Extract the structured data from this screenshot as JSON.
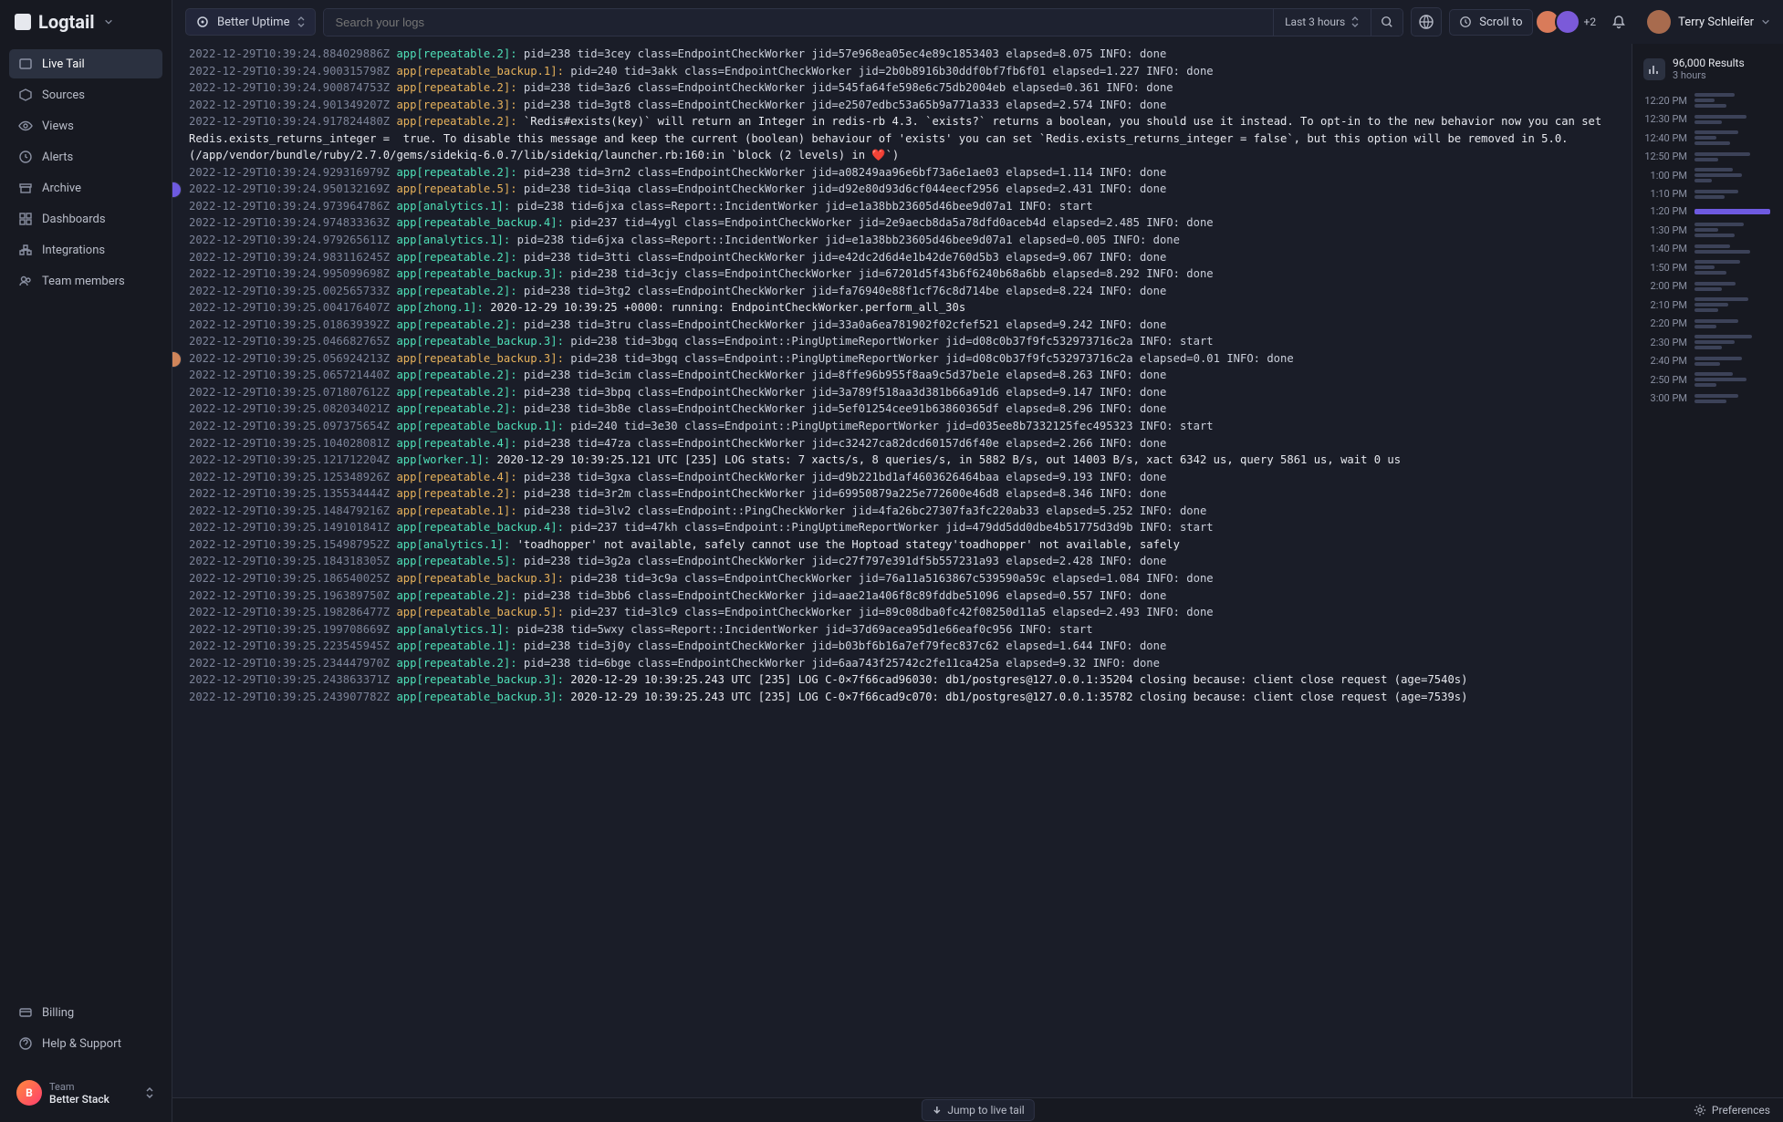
{
  "brand": "Logtail",
  "sidebar": {
    "items": [
      {
        "label": "Live Tail",
        "active": true,
        "icon": "live-tail-icon"
      },
      {
        "label": "Sources",
        "icon": "sources-icon"
      },
      {
        "label": "Views",
        "icon": "views-icon"
      },
      {
        "label": "Alerts",
        "icon": "alerts-icon"
      },
      {
        "label": "Archive",
        "icon": "archive-icon"
      },
      {
        "label": "Dashboards",
        "icon": "dashboards-icon"
      },
      {
        "label": "Integrations",
        "icon": "integrations-icon"
      },
      {
        "label": "Team members",
        "icon": "team-members-icon"
      }
    ],
    "bottom": [
      {
        "label": "Billing",
        "icon": "billing-icon"
      },
      {
        "label": "Help & Support",
        "icon": "help-icon"
      }
    ],
    "team": {
      "prefix": "Team",
      "name": "Better Stack"
    }
  },
  "topbar": {
    "source_selector": "Better Uptime",
    "search_placeholder": "Search your logs",
    "time_range": "Last 3 hours",
    "scroll_to": "Scroll to",
    "avatar_plus": "+2",
    "user_name": "Terry Schleifer"
  },
  "results": {
    "count": "96,000 Results",
    "subtitle": "3 hours"
  },
  "timeline_labels": [
    "12:20 PM",
    "12:30 PM",
    "12:40 PM",
    "12:50 PM",
    "1:00 PM",
    "1:10 PM",
    "1:20 PM",
    "1:30 PM",
    "1:40 PM",
    "1:50 PM",
    "2:00 PM",
    "2:10 PM",
    "2:20 PM",
    "2:30 PM",
    "2:40 PM",
    "2:50 PM",
    "3:00 PM"
  ],
  "timeline_highlight_index": 6,
  "bottombar": {
    "jump": "Jump to live tail",
    "prefs": "Preferences"
  },
  "logs": [
    {
      "ts": "2022-12-29T10:39:24.884029886Z",
      "tag": "app[repeatable.2]:",
      "tag_color": "green",
      "rest": "pid=238 tid=3cey class=EndpointCheckWorker jid=57e968ea05ec4e89c1853403 elapsed=8.075 INFO: done"
    },
    {
      "ts": "2022-12-29T10:39:24.900315798Z",
      "tag": "app[repeatable_backup.1]:",
      "tag_color": "orange",
      "rest": "pid=240 tid=3akk class=EndpointCheckWorker jid=2b0b8916b30ddf0bf7fb6f01 elapsed=1.227 INFO: done"
    },
    {
      "ts": "2022-12-29T10:39:24.900874753Z",
      "tag": "app[repeatable.2]:",
      "tag_color": "orange",
      "rest": "pid=238 tid=3az6 class=EndpointCheckWorker jid=545fa64fe598e6c75db2004eb elapsed=0.361 INFO: done"
    },
    {
      "ts": "2022-12-29T10:39:24.901349207Z",
      "tag": "app[repeatable.3]:",
      "tag_color": "orange",
      "rest": "pid=238 tid=3gt8 class=EndpointCheckWorker jid=e2507edbc53a65b9a771a333 elapsed=2.574 INFO: done"
    },
    {
      "ts": "2022-12-29T10:39:24.917824480Z",
      "tag": "app[repeatable.2]:",
      "tag_color": "orange",
      "rest": "`Redis#exists(key)` will return an Integer in redis-rb 4.3. `exists?` returns a boolean, you should use it instead. To opt-in to the new behavior now you can set Redis.exists_returns_integer =  true. To disable this message and keep the current (boolean) behaviour of 'exists' you can set `Redis.exists_returns_integer = false`, but this option will be removed in 5.0. (/app/vendor/bundle/ruby/2.7.0/gems/sidekiq-6.0.7/lib/sidekiq/launcher.rb:160:in `block (2 levels) in ❤️`)",
      "text": true
    },
    {
      "ts": "2022-12-29T10:39:24.929316979Z",
      "tag": "app[repeatable.2]:",
      "tag_color": "green",
      "rest": "pid=238 tid=3rn2 class=EndpointCheckWorker jid=a08249aa96e6bf73a6e1ae03 elapsed=1.114 INFO: done"
    },
    {
      "ts": "2022-12-29T10:39:24.950132169Z",
      "tag": "app[repeatable.5]:",
      "tag_color": "orange",
      "rest": "pid=238 tid=3iqa class=EndpointCheckWorker jid=d92e80d93d6cf044eecf2956 elapsed=2.431 INFO: done",
      "avatar": 1
    },
    {
      "ts": "2022-12-29T10:39:24.973964786Z",
      "tag": "app[analytics.1]:",
      "tag_color": "green",
      "rest": "pid=238 tid=6jxa class=Report::IncidentWorker jid=e1a38bb23605d46bee9d07a1 INFO: start"
    },
    {
      "ts": "2022-12-29T10:39:24.974833363Z",
      "tag": "app[repeatable_backup.4]:",
      "tag_color": "green",
      "rest": "pid=237 tid=4ygl class=EndpointCheckWorker jid=2e9aecb8da5a78dfd0aceb4d elapsed=2.485 INFO: done"
    },
    {
      "ts": "2022-12-29T10:39:24.979265611Z",
      "tag": "app[analytics.1]:",
      "tag_color": "green",
      "rest": "pid=238 tid=6jxa class=Report::IncidentWorker jid=e1a38bb23605d46bee9d07a1 elapsed=0.005 INFO: done"
    },
    {
      "ts": "2022-12-29T10:39:24.983116245Z",
      "tag": "app[repeatable.2]:",
      "tag_color": "green",
      "rest": "pid=238 tid=3tti class=EndpointCheckWorker jid=e42dc2d6d4e1b42de760d5b3 elapsed=9.067 INFO: done"
    },
    {
      "ts": "2022-12-29T10:39:24.995099698Z",
      "tag": "app[repeatable_backup.3]:",
      "tag_color": "green",
      "rest": "pid=238 tid=3cjy class=EndpointCheckWorker jid=67201d5f43b6f6240b68a6bb elapsed=8.292 INFO: done"
    },
    {
      "ts": "2022-12-29T10:39:25.002565733Z",
      "tag": "app[repeatable.2]:",
      "tag_color": "green",
      "rest": "pid=238 tid=3tg2 class=EndpointCheckWorker jid=fa76940e88f1cf76c8d714be elapsed=8.224 INFO: done"
    },
    {
      "ts": "2022-12-29T10:39:25.004176407Z",
      "tag": "app[zhong.1]:",
      "tag_color": "green",
      "rest": "2020-12-29 10:39:25 +0000: running: EndpointCheckWorker.perform_all_30s",
      "text": true
    },
    {
      "ts": "2022-12-29T10:39:25.018639392Z",
      "tag": "app[repeatable.2]:",
      "tag_color": "green",
      "rest": "pid=238 tid=3tru class=EndpointCheckWorker jid=33a0a6ea781902f02cfef521 elapsed=9.242 INFO: done"
    },
    {
      "ts": "2022-12-29T10:39:25.046682765Z",
      "tag": "app[repeatable_backup.3]:",
      "tag_color": "green",
      "rest": "pid=238 tid=3bgq class=Endpoint::PingUptimeReportWorker jid=d08c0b37f9fc532973716c2a INFO: start"
    },
    {
      "ts": "2022-12-29T10:39:25.056924213Z",
      "tag": "app[repeatable_backup.3]:",
      "tag_color": "orange",
      "rest": "pid=238 tid=3bgq class=Endpoint::PingUptimeReportWorker jid=d08c0b37f9fc532973716c2a elapsed=0.01 INFO: done",
      "avatar": 2
    },
    {
      "ts": "2022-12-29T10:39:25.065721440Z",
      "tag": "app[repeatable.2]:",
      "tag_color": "green",
      "rest": "pid=238 tid=3cim class=EndpointCheckWorker jid=8ffe96b955f8aa9c5d37be1e elapsed=8.263 INFO: done"
    },
    {
      "ts": "2022-12-29T10:39:25.071807612Z",
      "tag": "app[repeatable.2]:",
      "tag_color": "green",
      "rest": "pid=238 tid=3bpq class=EndpointCheckWorker jid=3a789f518aa3d381b66a91d6 elapsed=9.147 INFO: done"
    },
    {
      "ts": "2022-12-29T10:39:25.082034021Z",
      "tag": "app[repeatable.2]:",
      "tag_color": "green",
      "rest": "pid=238 tid=3b8e class=EndpointCheckWorker jid=5ef01254cee91b63860365df elapsed=8.296 INFO: done"
    },
    {
      "ts": "2022-12-29T10:39:25.097375654Z",
      "tag": "app[repeatable_backup.1]:",
      "tag_color": "green",
      "rest": "pid=240 tid=3e30 class=Endpoint::PingUptimeReportWorker jid=d035ee8b7332125fec495323 INFO: start"
    },
    {
      "ts": "2022-12-29T10:39:25.104028081Z",
      "tag": "app[repeatable.4]:",
      "tag_color": "green",
      "rest": "pid=238 tid=47za class=EndpointCheckWorker jid=c32427ca82dcd60157d6f40e elapsed=2.266 INFO: done"
    },
    {
      "ts": "2022-12-29T10:39:25.121712204Z",
      "tag": "app[worker.1]:",
      "tag_color": "green",
      "rest": "2020-12-29 10:39:25.121 UTC [235] LOG stats: 7 xacts/s, 8 queries/s, in 5882 B/s, out 14003 B/s, xact 6342 us, query 5861 us, wait 0 us",
      "text": true
    },
    {
      "ts": "2022-12-29T10:39:25.125348926Z",
      "tag": "app[repeatable.4]:",
      "tag_color": "orange",
      "rest": "pid=238 tid=3gxa class=EndpointCheckWorker jid=d9b221bd1af4603626464baa elapsed=9.193 INFO: done"
    },
    {
      "ts": "2022-12-29T10:39:25.135534444Z",
      "tag": "app[repeatable.2]:",
      "tag_color": "orange",
      "rest": "pid=238 tid=3r2m class=EndpointCheckWorker jid=69950879a225e772600e46d8 elapsed=8.346 INFO: done"
    },
    {
      "ts": "2022-12-29T10:39:25.148479216Z",
      "tag": "app[repeatable.1]:",
      "tag_color": "orange",
      "rest": "pid=238 tid=3lv2 class=Endpoint::PingCheckWorker jid=4fa26bc27307fa3fc220ab33 elapsed=5.252 INFO: done"
    },
    {
      "ts": "2022-12-29T10:39:25.149101841Z",
      "tag": "app[repeatable_backup.4]:",
      "tag_color": "green",
      "rest": "pid=237 tid=47kh class=Endpoint::PingUptimeReportWorker jid=479dd5dd0dbe4b51775d3d9b INFO: start"
    },
    {
      "ts": "2022-12-29T10:39:25.154987952Z",
      "tag": "app[analytics.1]:",
      "tag_color": "green",
      "rest": "'toadhopper' not available, safely cannot use the Hoptoad stategy'toadhopper' not available, safely",
      "text": true
    },
    {
      "ts": "2022-12-29T10:39:25.184318305Z",
      "tag": "app[repeatable.5]:",
      "tag_color": "green",
      "rest": "pid=238 tid=3g2a class=EndpointCheckWorker jid=c27f797e391df5b557231a93 elapsed=2.428 INFO: done"
    },
    {
      "ts": "2022-12-29T10:39:25.186540025Z",
      "tag": "app[repeatable_backup.3]:",
      "tag_color": "orange",
      "rest": "pid=238 tid=3c9a class=EndpointCheckWorker jid=76a11a5163867c539590a59c elapsed=1.084 INFO: done"
    },
    {
      "ts": "2022-12-29T10:39:25.196389750Z",
      "tag": "app[repeatable.2]:",
      "tag_color": "green",
      "rest": "pid=238 tid=3bb6 class=EndpointCheckWorker jid=aae21a406f8c89fddbe51096 elapsed=0.557 INFO: done"
    },
    {
      "ts": "2022-12-29T10:39:25.198286477Z",
      "tag": "app[repeatable_backup.5]:",
      "tag_color": "orange",
      "rest": "pid=237 tid=3lc9 class=EndpointCheckWorker jid=89c08dba0fc42f08250d11a5 elapsed=2.493 INFO: done"
    },
    {
      "ts": "2022-12-29T10:39:25.199708669Z",
      "tag": "app[analytics.1]:",
      "tag_color": "green",
      "rest": "pid=238 tid=5wxy class=Report::IncidentWorker jid=37d69acea95d1e66eaf0c956 INFO: start"
    },
    {
      "ts": "2022-12-29T10:39:25.223545945Z",
      "tag": "app[repeatable.1]:",
      "tag_color": "green",
      "rest": "pid=238 tid=3j0y class=EndpointCheckWorker jid=b03bf6b16a7ef79fec837c62 elapsed=1.644 INFO: done"
    },
    {
      "ts": "2022-12-29T10:39:25.234447970Z",
      "tag": "app[repeatable.2]:",
      "tag_color": "green",
      "rest": "pid=238 tid=6bge class=EndpointCheckWorker jid=6aa743f25742c2fe11ca425a elapsed=9.32 INFO: done"
    },
    {
      "ts": "2022-12-29T10:39:25.243863371Z",
      "tag": "app[repeatable_backup.3]:",
      "tag_color": "green",
      "rest": "2020-12-29 10:39:25.243 UTC [235] LOG C-0×7f66cad96030: db1/postgres@127.0.0.1:35204 closing because: client close request (age=7540s)",
      "text": true
    },
    {
      "ts": "2022-12-29T10:39:25.243907782Z",
      "tag": "app[repeatable_backup.3]:",
      "tag_color": "green",
      "rest": "2020-12-29 10:39:25.243 UTC [235] LOG C-0×7f66cad9c070: db1/postgres@127.0.0.1:35782 closing because: client close request (age=7539s)",
      "text": true
    }
  ]
}
